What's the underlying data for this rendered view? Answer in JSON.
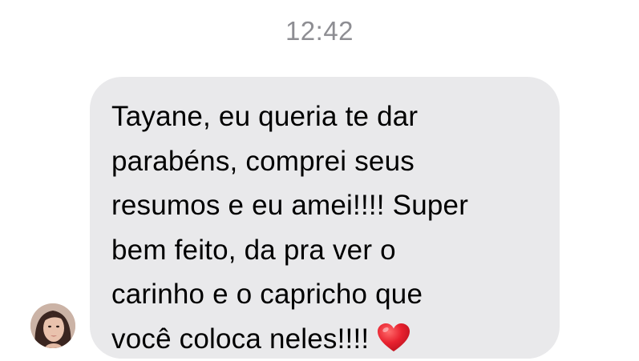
{
  "conversation": {
    "timestamp": "12:42",
    "message": {
      "text": "Tayane, eu queria te dar\nparabéns, comprei seus\nresumos e eu amei!!!! Super\nbem feito, da pra ver o\ncarinho e o capricho que\nvocê coloca neles!!!!",
      "emoji_icon": "red-heart-icon",
      "bubble_color": "#e9e9eb"
    },
    "sender_avatar": "avatar-photo"
  },
  "colors": {
    "timestamp": "#8e8e93",
    "text": "#000000",
    "background": "#ffffff",
    "heart": "#e0202e"
  }
}
